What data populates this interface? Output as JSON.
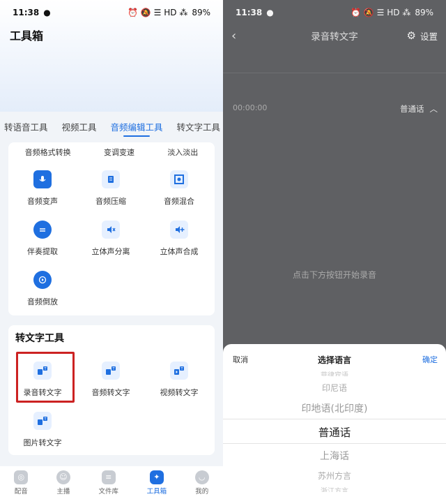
{
  "status": {
    "time": "11:38",
    "battery": "89%",
    "icons": "⏰ 🔕 ☰ HD ⁂"
  },
  "left": {
    "title": "工具箱",
    "tabs": [
      "转语音工具",
      "视频工具",
      "音频编辑工具",
      "转文字工具"
    ],
    "audio_top_row": [
      "音频格式转换",
      "变调变速",
      "淡入淡出"
    ],
    "audio_items": [
      {
        "label": "音频变声",
        "icon": "microphone-icon"
      },
      {
        "label": "音频压缩",
        "icon": "compress-icon"
      },
      {
        "label": "音频混合",
        "icon": "mix-icon"
      },
      {
        "label": "伴奏提取",
        "icon": "extract-icon"
      },
      {
        "label": "立体声分离",
        "icon": "speaker-split-icon"
      },
      {
        "label": "立体声合成",
        "icon": "speaker-merge-icon"
      },
      {
        "label": "音频倒放",
        "icon": "reverse-icon"
      }
    ],
    "text_section_title": "转文字工具",
    "text_items": [
      {
        "label": "录音转文字",
        "icon": "record-to-text-icon"
      },
      {
        "label": "音频转文字",
        "icon": "audio-to-text-icon"
      },
      {
        "label": "视频转文字",
        "icon": "video-to-text-icon"
      },
      {
        "label": "图片转文字",
        "icon": "image-to-text-icon"
      }
    ],
    "nav": [
      {
        "label": "配音",
        "active": false
      },
      {
        "label": "主播",
        "active": false
      },
      {
        "label": "文件库",
        "active": false
      },
      {
        "label": "工具箱",
        "active": true
      },
      {
        "label": "我的",
        "active": false
      }
    ]
  },
  "right": {
    "title": "录音转文字",
    "settings_label": "设置",
    "timer": "00:00:00",
    "language": "普通话",
    "hint": "点击下方按钮开始录音",
    "sheet": {
      "cancel": "取消",
      "title": "选择语言",
      "confirm": "确定",
      "options": [
        "菲律宾语",
        "印尼语",
        "印地语(北印度)",
        "普通话",
        "上海话",
        "苏州方言",
        "浙江方言"
      ]
    }
  },
  "colors": {
    "accent": "#1f6fe0",
    "highlight": "#cc2222"
  }
}
